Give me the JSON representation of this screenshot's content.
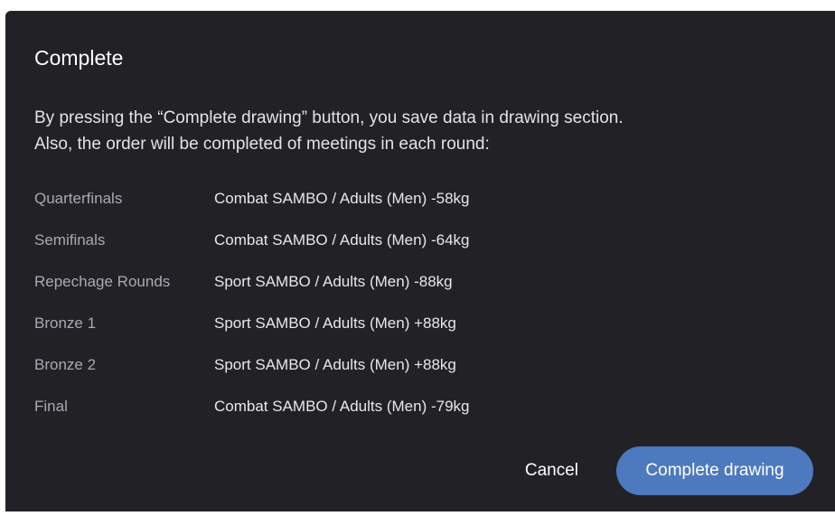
{
  "dialog": {
    "title": "Complete",
    "description_line1": "By pressing the “Complete drawing” button, you save data in drawing section.",
    "description_line2": "Also, the order will be completed of meetings in each round:",
    "rounds": [
      {
        "name": "Quarterfinals",
        "value": "Combat SAMBO / Adults (Men) -58kg"
      },
      {
        "name": "Semifinals",
        "value": "Combat SAMBO / Adults (Men) -64kg"
      },
      {
        "name": "Repechage Rounds",
        "value": "Sport SAMBO / Adults (Men) -88kg"
      },
      {
        "name": "Bronze 1",
        "value": "Sport SAMBO / Adults (Men) +88kg"
      },
      {
        "name": "Bronze 2",
        "value": "Sport SAMBO / Adults (Men) +88kg"
      },
      {
        "name": "Final",
        "value": "Combat SAMBO / Adults (Men) -79kg"
      }
    ],
    "cancel_label": "Cancel",
    "complete_label": "Complete drawing"
  },
  "colors": {
    "dialog_background": "#222226",
    "primary_button": "#4d79bf",
    "round_name_text": "#a9a9b1",
    "round_value_text": "#e8e8eb"
  }
}
